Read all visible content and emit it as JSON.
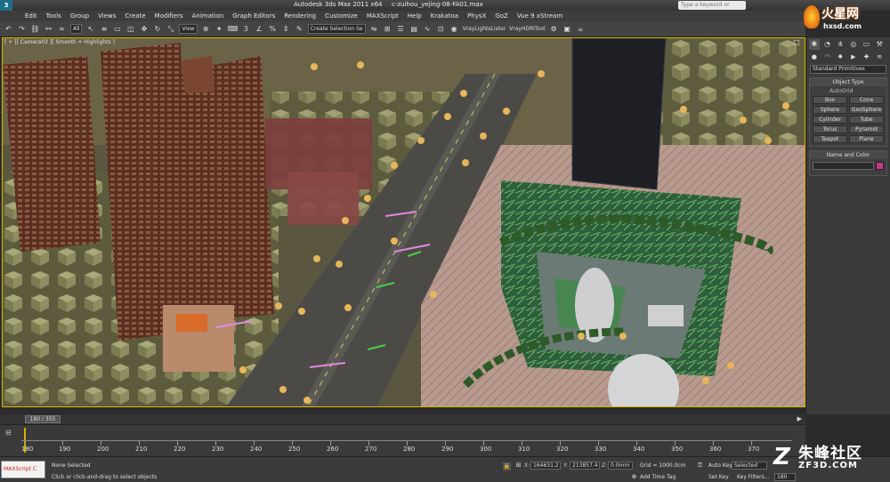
{
  "window": {
    "title": "Autodesk 3ds Max  2011 x64",
    "file": "c-zuihou_yejing-08-FA01.max",
    "search_placeholder": "Type a keyword or phrase"
  },
  "watermarks": {
    "top_brand": "火星网",
    "top_url": "hxsd.com",
    "bottom_brand": "朱峰社区",
    "bottom_url": "ZF3D.COM"
  },
  "menu": [
    "Edit",
    "Tools",
    "Group",
    "Views",
    "Create",
    "Modifiers",
    "Animation",
    "Graph Editors",
    "Rendering",
    "Customize",
    "MAXScript",
    "Help",
    "Krakatoa",
    "PhysX",
    "GoZ",
    "Vue 9 xStream"
  ],
  "toolbar": {
    "filter_select": "All",
    "ref_coord_select": "View",
    "named_selection": "Create Selection Se",
    "vray_lights_label": "VrayLightsLister",
    "vray_hdri_label": "VrayHDRITool"
  },
  "viewport": {
    "label": "[ + ][ Camera03 ][ Smooth + Highlights ]"
  },
  "command_panel": {
    "category_dropdown": "Standard Primitives",
    "object_type_title": "Object Type",
    "autogrid_label": "AutoGrid",
    "primitives": [
      "Box",
      "Cone",
      "Sphere",
      "GeoSphere",
      "Cylinder",
      "Tube",
      "Torus",
      "Pyramid",
      "Teapot",
      "Plane"
    ],
    "name_color_title": "Name and Color"
  },
  "time_slider": {
    "frame_display": "180 / 355"
  },
  "trackbar": {
    "ticks": [
      "180",
      "190",
      "200",
      "210",
      "220",
      "230",
      "240",
      "250",
      "260",
      "270",
      "280",
      "290",
      "300",
      "310",
      "320",
      "330",
      "340",
      "350",
      "360",
      "370"
    ]
  },
  "status": {
    "maxscript_label": "MAXScript C",
    "selection_status": "None Selected",
    "prompt": "Click or click-and-drag to select objects",
    "x_value": "164631.2",
    "y_value": "213857.4",
    "z_value": "0.0mm",
    "grid_label": "Grid = 1000.0cm",
    "add_time_tag": "Add Time Tag",
    "auto_key": "Auto Key",
    "set_key": "Set Key",
    "selected_dropdown": "Selected",
    "key_filters": "Key Filters...",
    "current_frame": "180"
  }
}
